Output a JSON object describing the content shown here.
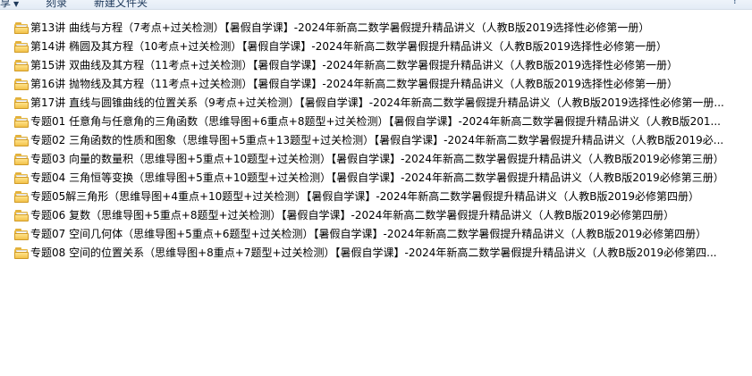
{
  "toolbar": {
    "organize_label": "享",
    "burn_label": "刻录",
    "new_folder_label": "新建文件夹"
  },
  "files": [
    {
      "name": "第13讲 曲线与方程（7考点+过关检测）【暑假自学课】-2024年新高二数学暑假提升精品讲义（人教B版2019选择性必修第一册）",
      "icon": "folder-icon"
    },
    {
      "name": "第14讲 椭圆及其方程（10考点+过关检测）【暑假自学课】-2024年新高二数学暑假提升精品讲义（人教B版2019选择性必修第一册）",
      "icon": "folder-icon"
    },
    {
      "name": "第15讲 双曲线及其方程（11考点+过关检测）【暑假自学课】-2024年新高二数学暑假提升精品讲义（人教B版2019选择性必修第一册）",
      "icon": "folder-icon"
    },
    {
      "name": "第16讲 抛物线及其方程（11考点+过关检测）【暑假自学课】-2024年新高二数学暑假提升精品讲义（人教B版2019选择性必修第一册）",
      "icon": "folder-icon"
    },
    {
      "name": "第17讲 直线与圆锥曲线的位置关系（9考点+过关检测）【暑假自学课】-2024年新高二数学暑假提升精品讲义（人教B版2019选择性必修第一册...",
      "icon": "folder-icon"
    },
    {
      "name": "专题01 任意角与任意角的三角函数（思维导图+6重点+8题型+过关检测）【暑假自学课】-2024年新高二数学暑假提升精品讲义（人教B版201...",
      "icon": "folder-icon"
    },
    {
      "name": "专题02 三角函数的性质和图象（思维导图+5重点+13题型+过关检测）【暑假自学课】-2024年新高二数学暑假提升精品讲义（人教B版2019必...",
      "icon": "folder-icon"
    },
    {
      "name": "专题03 向量的数量积（思维导图+5重点+10题型+过关检测）【暑假自学课】-2024年新高二数学暑假提升精品讲义（人教B版2019必修第三册）",
      "icon": "folder-icon"
    },
    {
      "name": "专题04 三角恒等变换（思维导图+5重点+10题型+过关检测）【暑假自学课】-2024年新高二数学暑假提升精品讲义（人教B版2019必修第三册）",
      "icon": "folder-icon"
    },
    {
      "name": "专题05解三角形（思维导图+4重点+10题型+过关检测）【暑假自学课】-2024年新高二数学暑假提升精品讲义（人教B版2019必修第四册）",
      "icon": "folder-icon"
    },
    {
      "name": "专题06 复数（思维导图+5重点+8题型+过关检测）【暑假自学课】-2024年新高二数学暑假提升精品讲义（人教B版2019必修第四册）",
      "icon": "folder-icon"
    },
    {
      "name": "专题07 空间几何体（思维导图+5重点+6题型+过关检测）【暑假自学课】-2024年新高二数学暑假提升精品讲义（人教B版2019必修第四册）",
      "icon": "folder-icon"
    },
    {
      "name": "专题08 空间的位置关系（思维导图+8重点+7题型+过关检测）【暑假自学课】-2024年新高二数学暑假提升精品讲义（人教B版2019必修第四...",
      "icon": "folder-icon"
    }
  ]
}
